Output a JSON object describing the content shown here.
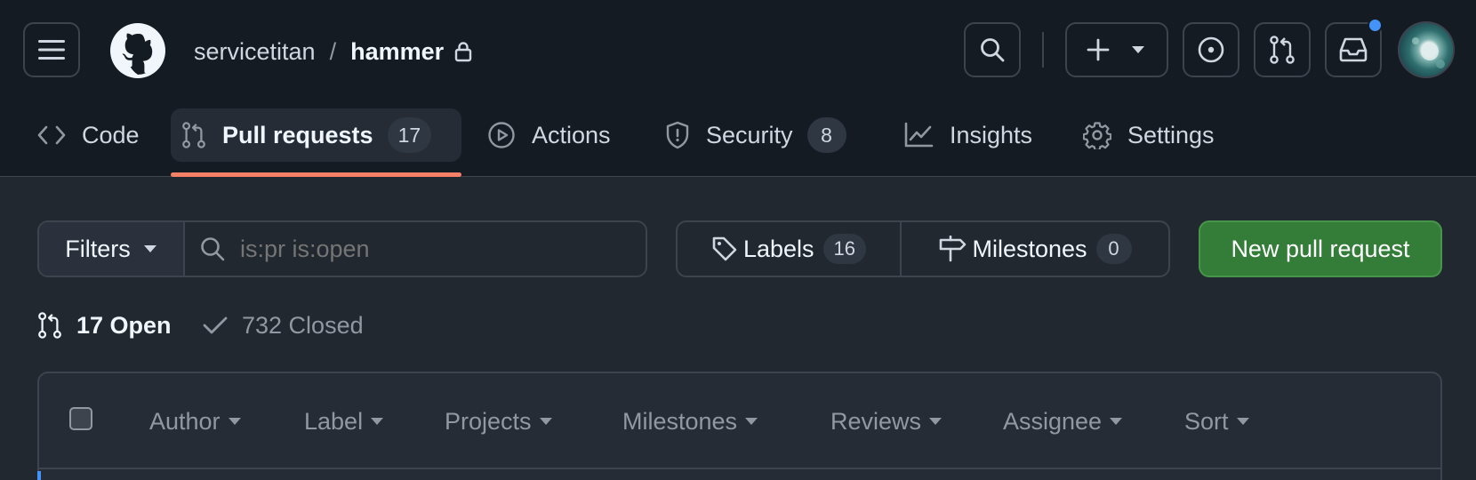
{
  "header": {
    "owner": "servicetitan",
    "separator": "/",
    "repo": "hammer"
  },
  "tabs": [
    {
      "label": "Code"
    },
    {
      "label": "Pull requests",
      "count": "17"
    },
    {
      "label": "Actions"
    },
    {
      "label": "Security",
      "count": "8"
    },
    {
      "label": "Insights"
    },
    {
      "label": "Settings"
    }
  ],
  "toolbar": {
    "filters_label": "Filters",
    "search_placeholder": "is:pr is:open",
    "labels_label": "Labels",
    "labels_count": "16",
    "milestones_label": "Milestones",
    "milestones_count": "0",
    "new_pr_label": "New pull request"
  },
  "states": {
    "open_label": "17 Open",
    "closed_label": "732 Closed"
  },
  "list_header": {
    "filters": [
      "Author",
      "Label",
      "Projects",
      "Milestones",
      "Reviews",
      "Assignee",
      "Sort"
    ]
  },
  "colors": {
    "accent_underline": "#f78166",
    "primary_button": "#347d39",
    "notification_dot": "#4493f8"
  }
}
